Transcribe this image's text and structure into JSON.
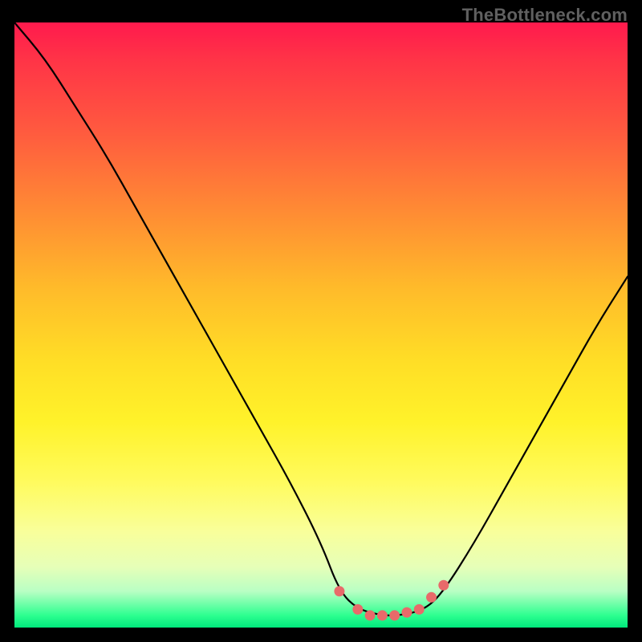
{
  "watermark": "TheBottleneck.com",
  "colors": {
    "curve_stroke": "#000000",
    "marker_fill": "#e86a6a",
    "marker_stroke": "#c94f4f",
    "frame": "#000000"
  },
  "chart_data": {
    "type": "line",
    "title": "",
    "xlabel": "",
    "ylabel": "",
    "xlim": [
      0,
      100
    ],
    "ylim": [
      0,
      100
    ],
    "grid": false,
    "legend": false,
    "notes": "Bottleneck percentage curve. Background vertical gradient runs from red (high bottleneck, top) to green (low bottleneck, bottom). Flat green region near x≈53–67 is the sweet spot. No axes or tick labels are rendered in the image; x/y placement estimated from pixel positions.",
    "series": [
      {
        "name": "bottleneck-curve",
        "x": [
          0,
          5,
          10,
          15,
          20,
          25,
          30,
          35,
          40,
          45,
          50,
          53,
          56,
          60,
          63,
          67,
          70,
          75,
          80,
          85,
          90,
          95,
          100
        ],
        "y": [
          100,
          94,
          86,
          78,
          69,
          60,
          51,
          42,
          33,
          24,
          14,
          6,
          3,
          2,
          2,
          3,
          6,
          14,
          23,
          32,
          41,
          50,
          58
        ]
      }
    ],
    "markers": [
      {
        "x": 53,
        "y": 6
      },
      {
        "x": 56,
        "y": 3
      },
      {
        "x": 58,
        "y": 2
      },
      {
        "x": 60,
        "y": 2
      },
      {
        "x": 62,
        "y": 2
      },
      {
        "x": 64,
        "y": 2.5
      },
      {
        "x": 66,
        "y": 3
      },
      {
        "x": 68,
        "y": 5
      },
      {
        "x": 70,
        "y": 7
      }
    ]
  }
}
